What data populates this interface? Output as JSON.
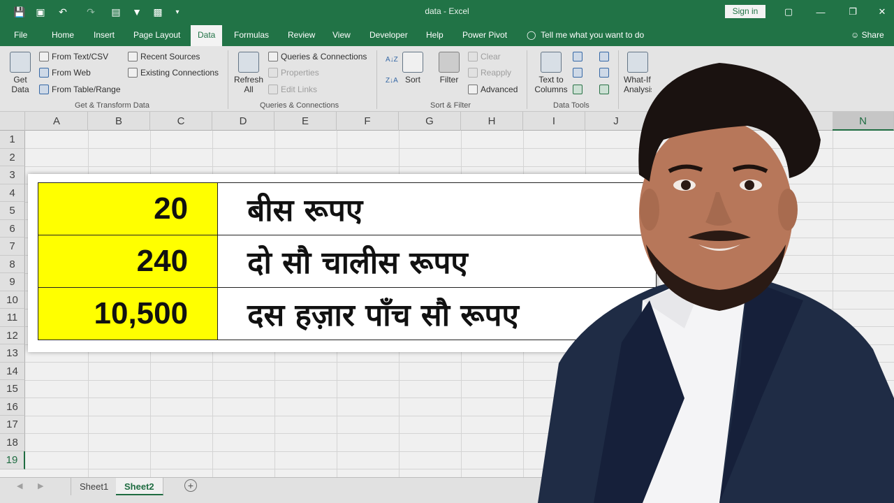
{
  "window": {
    "title": "data  -  Excel",
    "sign_in": "Sign in"
  },
  "ribbon_tabs": [
    "File",
    "Home",
    "Insert",
    "Page Layout",
    "Data",
    "Formulas",
    "Review",
    "View",
    "Developer",
    "Help",
    "Power Pivot"
  ],
  "tell_me": "Tell me what you want to do",
  "share": "Share",
  "ribbon": {
    "get_data": "Get Data",
    "from_text_csv": "From Text/CSV",
    "from_web": "From Web",
    "from_table_range": "From Table/Range",
    "recent_sources": "Recent Sources",
    "existing_connections": "Existing Connections",
    "group_get_transform": "Get & Transform Data",
    "refresh_all": "Refresh All",
    "queries_connections": "Queries & Connections",
    "properties": "Properties",
    "edit_links": "Edit Links",
    "group_queries": "Queries & Connections",
    "sort": "Sort",
    "filter": "Filter",
    "clear": "Clear",
    "reapply": "Reapply",
    "advanced": "Advanced",
    "group_sort_filter": "Sort & Filter",
    "text_to_columns": "Text to Columns",
    "group_data_tools": "Data Tools",
    "what_if": "What-If Analysis"
  },
  "columns": [
    "A",
    "B",
    "C",
    "D",
    "E",
    "F",
    "G",
    "H",
    "I",
    "J",
    "N"
  ],
  "rows": [
    "1",
    "2",
    "3",
    "4",
    "5",
    "6",
    "7",
    "8",
    "9",
    "10",
    "11",
    "12",
    "13",
    "14",
    "15",
    "16",
    "17",
    "18",
    "19"
  ],
  "overlay_table": [
    {
      "number": "20",
      "words": "बीस रूपए"
    },
    {
      "number": "240",
      "words": "दो सौ चालीस रूपए"
    },
    {
      "number": "10,500",
      "words": "दस हज़ार पाँच सौ रूपए"
    }
  ],
  "sheets": [
    "Sheet1",
    "Sheet2"
  ],
  "active_sheet": "Sheet2",
  "colors": {
    "excel_green": "#217346",
    "highlight_yellow": "#ffff00"
  }
}
